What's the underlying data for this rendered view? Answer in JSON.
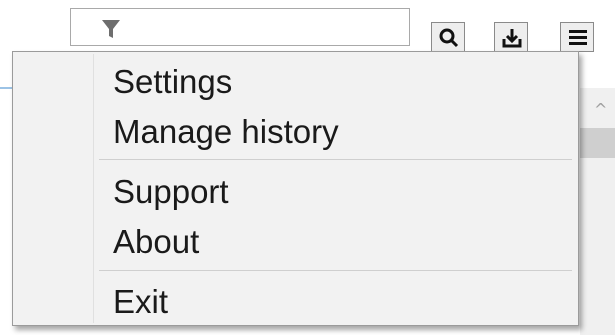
{
  "toolbar": {
    "filter_icon": "filter-icon",
    "search_icon": "search-icon",
    "download_icon": "download-icon",
    "menu_icon": "hamburger-menu-icon"
  },
  "context_menu": {
    "groups": [
      [
        "Settings",
        "Manage history"
      ],
      [
        "Support",
        "About"
      ],
      [
        "Exit"
      ]
    ]
  },
  "colors": {
    "menu_background": "#f2f2f2",
    "menu_border": "#9b9b9b",
    "separator": "#cfcfcf",
    "text": "#1a1a1a"
  }
}
